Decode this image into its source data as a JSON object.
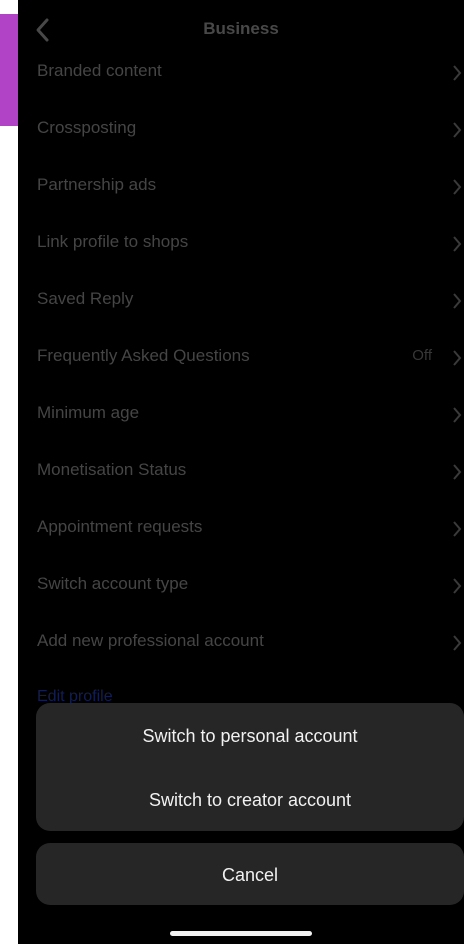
{
  "header": {
    "title": "Business",
    "back_icon": "chevron-left-icon"
  },
  "settings": [
    {
      "label": "Branded content",
      "value": ""
    },
    {
      "label": "Crossposting",
      "value": ""
    },
    {
      "label": "Partnership ads",
      "value": ""
    },
    {
      "label": "Link profile to shops",
      "value": ""
    },
    {
      "label": "Saved Reply",
      "value": ""
    },
    {
      "label": "Frequently Asked Questions",
      "value": "Off"
    },
    {
      "label": "Minimum age",
      "value": ""
    },
    {
      "label": "Monetisation Status",
      "value": ""
    },
    {
      "label": "Appointment requests",
      "value": ""
    },
    {
      "label": "Switch account type",
      "value": ""
    },
    {
      "label": "Add new professional account",
      "value": ""
    }
  ],
  "edit_profile_link": "Edit profile",
  "action_sheet": {
    "options": [
      "Switch to personal account",
      "Switch to creator account"
    ],
    "cancel": "Cancel"
  },
  "colors": {
    "background": "#000000",
    "sheet": "#262626",
    "accent_strip": "#b144c6",
    "link": "#1e2f7a"
  }
}
